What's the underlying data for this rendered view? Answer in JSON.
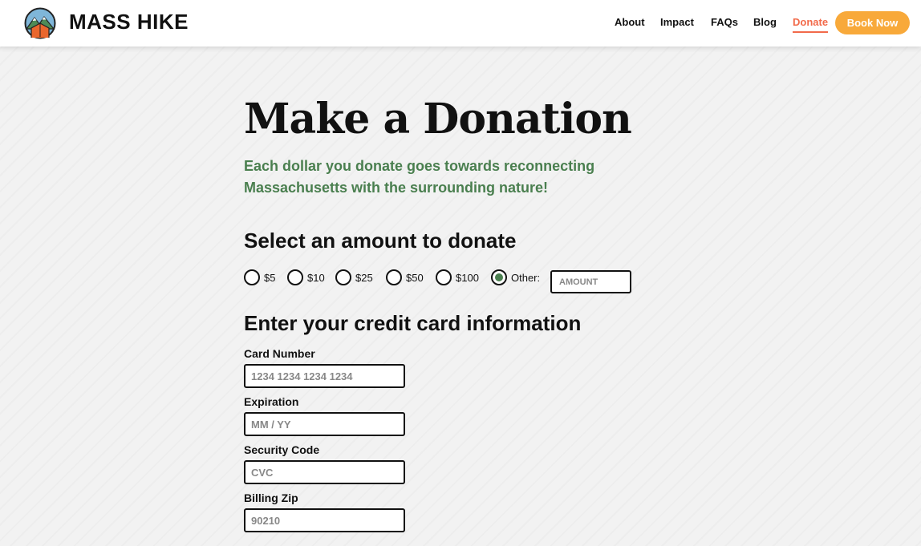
{
  "header": {
    "brand": "MASS HIKE",
    "nav": [
      {
        "label": "About"
      },
      {
        "label": "Impact"
      },
      {
        "label": "FAQs"
      },
      {
        "label": "Blog"
      },
      {
        "label": "Donate",
        "active": true
      }
    ],
    "cta": "Book Now"
  },
  "main": {
    "title": "Make a Donation",
    "subtitle": "Each dollar you donate goes towards reconnecting Massachusetts with the surrounding nature!",
    "amount_section": {
      "heading": "Select an amount to donate",
      "options": [
        {
          "label": "$5",
          "selected": false
        },
        {
          "label": "$10",
          "selected": false
        },
        {
          "label": "$25",
          "selected": false
        },
        {
          "label": "$50",
          "selected": false
        },
        {
          "label": "$100",
          "selected": false
        },
        {
          "label": "Other:",
          "selected": true
        }
      ],
      "amount_placeholder": "AMOUNT"
    },
    "card_section": {
      "heading": "Enter your credit card information",
      "fields": [
        {
          "label": "Card Number",
          "placeholder": "1234 1234 1234 1234"
        },
        {
          "label": "Expiration",
          "placeholder": "MM / YY"
        },
        {
          "label": "Security Code",
          "placeholder": "CVC"
        },
        {
          "label": "Billing Zip",
          "placeholder": "90210"
        }
      ]
    }
  },
  "colors": {
    "accent_green": "#4a7f4f",
    "accent_orange": "#f8a93a",
    "active_nav": "#f26a4a"
  }
}
